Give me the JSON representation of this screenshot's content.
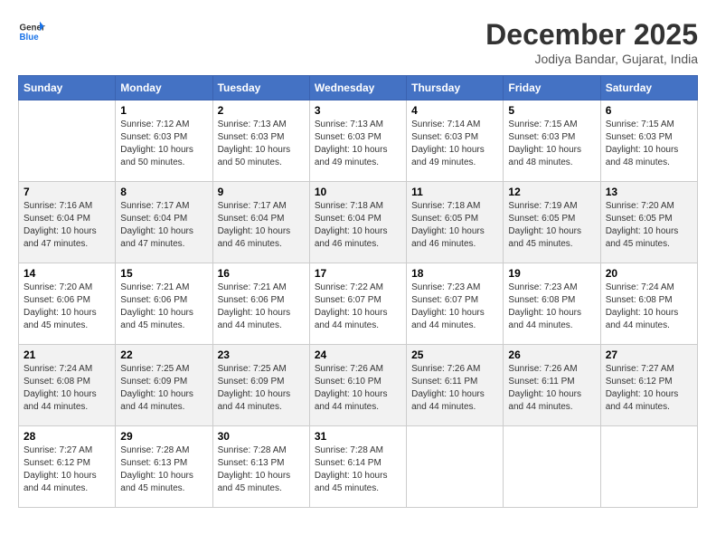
{
  "header": {
    "logo_line1": "General",
    "logo_line2": "Blue",
    "month": "December 2025",
    "location": "Jodiya Bandar, Gujarat, India"
  },
  "weekdays": [
    "Sunday",
    "Monday",
    "Tuesday",
    "Wednesday",
    "Thursday",
    "Friday",
    "Saturday"
  ],
  "weeks": [
    [
      {
        "day": "",
        "empty": true
      },
      {
        "day": "1",
        "sunrise": "7:12 AM",
        "sunset": "6:03 PM",
        "daylight": "10 hours and 50 minutes."
      },
      {
        "day": "2",
        "sunrise": "7:13 AM",
        "sunset": "6:03 PM",
        "daylight": "10 hours and 50 minutes."
      },
      {
        "day": "3",
        "sunrise": "7:13 AM",
        "sunset": "6:03 PM",
        "daylight": "10 hours and 49 minutes."
      },
      {
        "day": "4",
        "sunrise": "7:14 AM",
        "sunset": "6:03 PM",
        "daylight": "10 hours and 49 minutes."
      },
      {
        "day": "5",
        "sunrise": "7:15 AM",
        "sunset": "6:03 PM",
        "daylight": "10 hours and 48 minutes."
      },
      {
        "day": "6",
        "sunrise": "7:15 AM",
        "sunset": "6:03 PM",
        "daylight": "10 hours and 48 minutes."
      }
    ],
    [
      {
        "day": "7",
        "sunrise": "7:16 AM",
        "sunset": "6:04 PM",
        "daylight": "10 hours and 47 minutes."
      },
      {
        "day": "8",
        "sunrise": "7:17 AM",
        "sunset": "6:04 PM",
        "daylight": "10 hours and 47 minutes."
      },
      {
        "day": "9",
        "sunrise": "7:17 AM",
        "sunset": "6:04 PM",
        "daylight": "10 hours and 46 minutes."
      },
      {
        "day": "10",
        "sunrise": "7:18 AM",
        "sunset": "6:04 PM",
        "daylight": "10 hours and 46 minutes."
      },
      {
        "day": "11",
        "sunrise": "7:18 AM",
        "sunset": "6:05 PM",
        "daylight": "10 hours and 46 minutes."
      },
      {
        "day": "12",
        "sunrise": "7:19 AM",
        "sunset": "6:05 PM",
        "daylight": "10 hours and 45 minutes."
      },
      {
        "day": "13",
        "sunrise": "7:20 AM",
        "sunset": "6:05 PM",
        "daylight": "10 hours and 45 minutes."
      }
    ],
    [
      {
        "day": "14",
        "sunrise": "7:20 AM",
        "sunset": "6:06 PM",
        "daylight": "10 hours and 45 minutes."
      },
      {
        "day": "15",
        "sunrise": "7:21 AM",
        "sunset": "6:06 PM",
        "daylight": "10 hours and 45 minutes."
      },
      {
        "day": "16",
        "sunrise": "7:21 AM",
        "sunset": "6:06 PM",
        "daylight": "10 hours and 44 minutes."
      },
      {
        "day": "17",
        "sunrise": "7:22 AM",
        "sunset": "6:07 PM",
        "daylight": "10 hours and 44 minutes."
      },
      {
        "day": "18",
        "sunrise": "7:23 AM",
        "sunset": "6:07 PM",
        "daylight": "10 hours and 44 minutes."
      },
      {
        "day": "19",
        "sunrise": "7:23 AM",
        "sunset": "6:08 PM",
        "daylight": "10 hours and 44 minutes."
      },
      {
        "day": "20",
        "sunrise": "7:24 AM",
        "sunset": "6:08 PM",
        "daylight": "10 hours and 44 minutes."
      }
    ],
    [
      {
        "day": "21",
        "sunrise": "7:24 AM",
        "sunset": "6:08 PM",
        "daylight": "10 hours and 44 minutes."
      },
      {
        "day": "22",
        "sunrise": "7:25 AM",
        "sunset": "6:09 PM",
        "daylight": "10 hours and 44 minutes."
      },
      {
        "day": "23",
        "sunrise": "7:25 AM",
        "sunset": "6:09 PM",
        "daylight": "10 hours and 44 minutes."
      },
      {
        "day": "24",
        "sunrise": "7:26 AM",
        "sunset": "6:10 PM",
        "daylight": "10 hours and 44 minutes."
      },
      {
        "day": "25",
        "sunrise": "7:26 AM",
        "sunset": "6:11 PM",
        "daylight": "10 hours and 44 minutes."
      },
      {
        "day": "26",
        "sunrise": "7:26 AM",
        "sunset": "6:11 PM",
        "daylight": "10 hours and 44 minutes."
      },
      {
        "day": "27",
        "sunrise": "7:27 AM",
        "sunset": "6:12 PM",
        "daylight": "10 hours and 44 minutes."
      }
    ],
    [
      {
        "day": "28",
        "sunrise": "7:27 AM",
        "sunset": "6:12 PM",
        "daylight": "10 hours and 44 minutes."
      },
      {
        "day": "29",
        "sunrise": "7:28 AM",
        "sunset": "6:13 PM",
        "daylight": "10 hours and 45 minutes."
      },
      {
        "day": "30",
        "sunrise": "7:28 AM",
        "sunset": "6:13 PM",
        "daylight": "10 hours and 45 minutes."
      },
      {
        "day": "31",
        "sunrise": "7:28 AM",
        "sunset": "6:14 PM",
        "daylight": "10 hours and 45 minutes."
      },
      {
        "day": "",
        "empty": true
      },
      {
        "day": "",
        "empty": true
      },
      {
        "day": "",
        "empty": true
      }
    ]
  ]
}
